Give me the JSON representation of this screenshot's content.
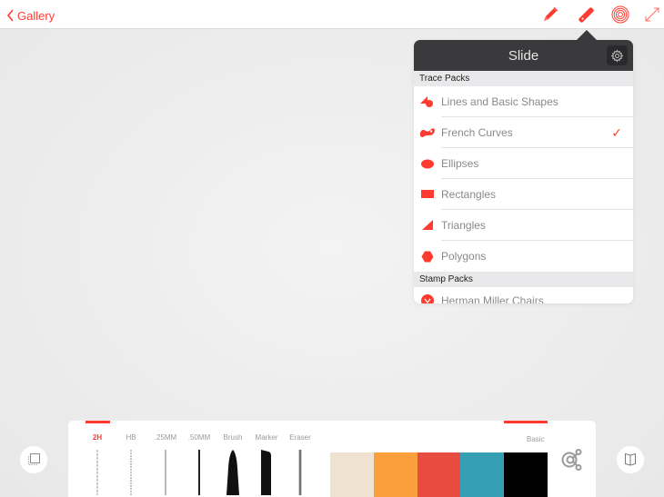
{
  "topbar": {
    "back_label": "Gallery",
    "tools": [
      {
        "name": "pencil",
        "icon": "pencil-icon"
      },
      {
        "name": "ruler",
        "icon": "ruler-icon",
        "active": true
      },
      {
        "name": "target",
        "icon": "concentric-circles-icon"
      },
      {
        "name": "expand",
        "icon": "expand-icon"
      }
    ]
  },
  "popover": {
    "title": "Slide",
    "settings_icon": "gear-icon",
    "sections": [
      {
        "header": "Trace Packs",
        "items": [
          {
            "label": "Lines and Basic Shapes",
            "icon": "shapes-icon",
            "checked": false
          },
          {
            "label": "French Curves",
            "icon": "french-curve-icon",
            "checked": true
          },
          {
            "label": "Ellipses",
            "icon": "ellipse-icon",
            "checked": false
          },
          {
            "label": "Rectangles",
            "icon": "rectangle-icon",
            "checked": false
          },
          {
            "label": "Triangles",
            "icon": "triangle-icon",
            "checked": false
          },
          {
            "label": "Polygons",
            "icon": "polygon-icon",
            "checked": false
          }
        ]
      },
      {
        "header": "Stamp Packs",
        "items": [
          {
            "label": "Herman Miller Chairs",
            "icon": "chair-stamp-icon",
            "checked": false
          }
        ]
      }
    ],
    "check_glyph": "✓"
  },
  "toolbar": {
    "tools": [
      {
        "label": "2H",
        "active": true
      },
      {
        "label": "HB",
        "active": false
      },
      {
        "label": ".25MM",
        "active": false
      },
      {
        "label": ".50MM",
        "active": false
      },
      {
        "label": "Brush",
        "active": false
      },
      {
        "label": "Marker",
        "active": false
      },
      {
        "label": "Eraser",
        "active": false
      }
    ],
    "palette": {
      "label": "Basic",
      "colors": [
        "#efe2d0",
        "#fb9f3c",
        "#e84c41",
        "#349fb5",
        "#000000"
      ]
    }
  },
  "side_buttons": {
    "left": "layers-icon",
    "right": "book-icon"
  },
  "accent": "#ff3b30"
}
